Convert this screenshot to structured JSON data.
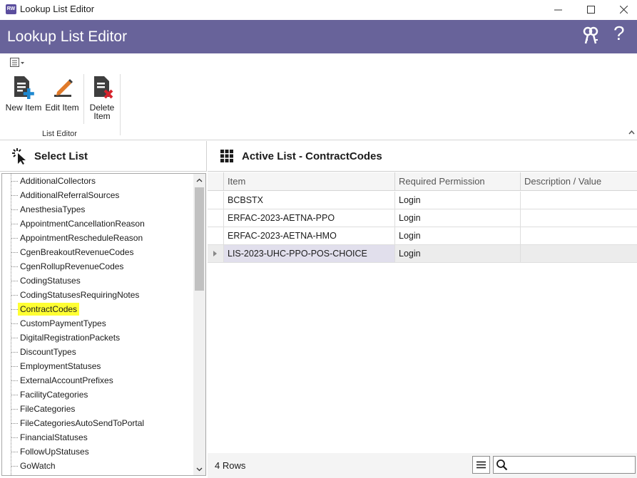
{
  "window": {
    "title": "Lookup List Editor",
    "app_icon_text": "RW"
  },
  "header": {
    "title": "Lookup List Editor",
    "help_glyph": "?",
    "background": "#68639a"
  },
  "ribbon": {
    "buttons": [
      {
        "label": "New Item",
        "icon": "new-document-icon"
      },
      {
        "label": "Edit Item",
        "icon": "edit-pencil-icon"
      },
      {
        "label_line1": "Delete",
        "label_line2": "Item",
        "icon": "delete-document-icon"
      }
    ],
    "group_label": "List Editor"
  },
  "select_list": {
    "title": "Select List",
    "selected": "ContractCodes",
    "items": [
      "AdditionalCollectors",
      "AdditionalReferralSources",
      "AnesthesiaTypes",
      "AppointmentCancellationReason",
      "AppointmentRescheduleReason",
      "CgenBreakoutRevenueCodes",
      "CgenRollupRevenueCodes",
      "CodingStatuses",
      "CodingStatusesRequiringNotes",
      "ContractCodes",
      "CustomPaymentTypes",
      "DigitalRegistrationPackets",
      "DiscountTypes",
      "EmploymentStatuses",
      "ExternalAccountPrefixes",
      "FacilityCategories",
      "FileCategories",
      "FileCategoriesAutoSendToPortal",
      "FinancialStatuses",
      "FollowUpStatuses",
      "GoWatch"
    ]
  },
  "active_list": {
    "title": "Active List - ContractCodes",
    "columns": [
      "Item",
      "Required Permission",
      "Description / Value"
    ],
    "rows": [
      {
        "item": "BCBSTX",
        "permission": "Login",
        "description": ""
      },
      {
        "item": "ERFAC-2023-AETNA-PPO",
        "permission": "Login",
        "description": ""
      },
      {
        "item": "ERFAC-2023-AETNA-HMO",
        "permission": "Login",
        "description": ""
      },
      {
        "item": "LIS-2023-UHC-PPO-POS-CHOICE",
        "permission": "Login",
        "description": ""
      }
    ],
    "focused_row": 3,
    "row_count_text": "4 Rows",
    "search": {
      "value": "",
      "placeholder": ""
    }
  }
}
